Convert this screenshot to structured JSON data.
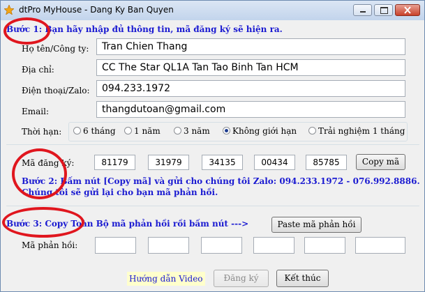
{
  "window": {
    "title": "dtPro MyHouse - Dang Ky Ban Quyen",
    "icon": "star-logo-icon",
    "controls": [
      "minimize-icon",
      "maximize-icon",
      "close-icon"
    ]
  },
  "step1": {
    "text": "Bước 1: Bạn hãy nhập đủ thông tin, mã đăng ký sẽ hiện ra."
  },
  "fields": {
    "name": {
      "label": "Họ tên/Công ty:",
      "value": "Tran Chien Thang"
    },
    "address": {
      "label": "Địa chỉ:",
      "value": "CC The Star QL1A Tan Tao Binh Tan  HCM"
    },
    "phone": {
      "label": "Điện thoại/Zalo:",
      "value": "094.233.1972"
    },
    "email": {
      "label": "Email:",
      "value": "thangdutoan@gmail.com"
    }
  },
  "term": {
    "label": "Thời hạn:",
    "options": [
      "6 tháng",
      "1 năm",
      "3 năm",
      "Không giới hạn",
      "Trải nghiệm 1 tháng"
    ],
    "selected": "Không giới hạn"
  },
  "registration": {
    "label": "Mã đăng ký:",
    "codes": [
      "81179",
      "31979",
      "34135",
      "00434",
      "85785"
    ],
    "copy_label": "Copy mã"
  },
  "step2": {
    "line1": "Bước 2: Bấm nút [Copy mã] và gửi cho chúng tôi Zalo: 094.233.1972 - 076.992.8886.",
    "line2": "Chúng tôi sẽ gửi lại cho bạn mã phản hồi."
  },
  "step3": {
    "text": "Bước 3: Copy Toàn Bộ mã phản hồi rồi bấm nút  --->",
    "paste_label": "Paste mã phản hồi"
  },
  "response": {
    "label": "Mã phản hồi:",
    "values": [
      "",
      "",
      "",
      "",
      "",
      ""
    ]
  },
  "footer": {
    "guide_label": "Hướng dẫn Video",
    "register_label": "Đăng ký",
    "exit_label": "Kết thúc"
  },
  "colors": {
    "step_text": "#1a1ad1",
    "annotation": "#e0161e",
    "guide_background": "#ffffcc"
  }
}
